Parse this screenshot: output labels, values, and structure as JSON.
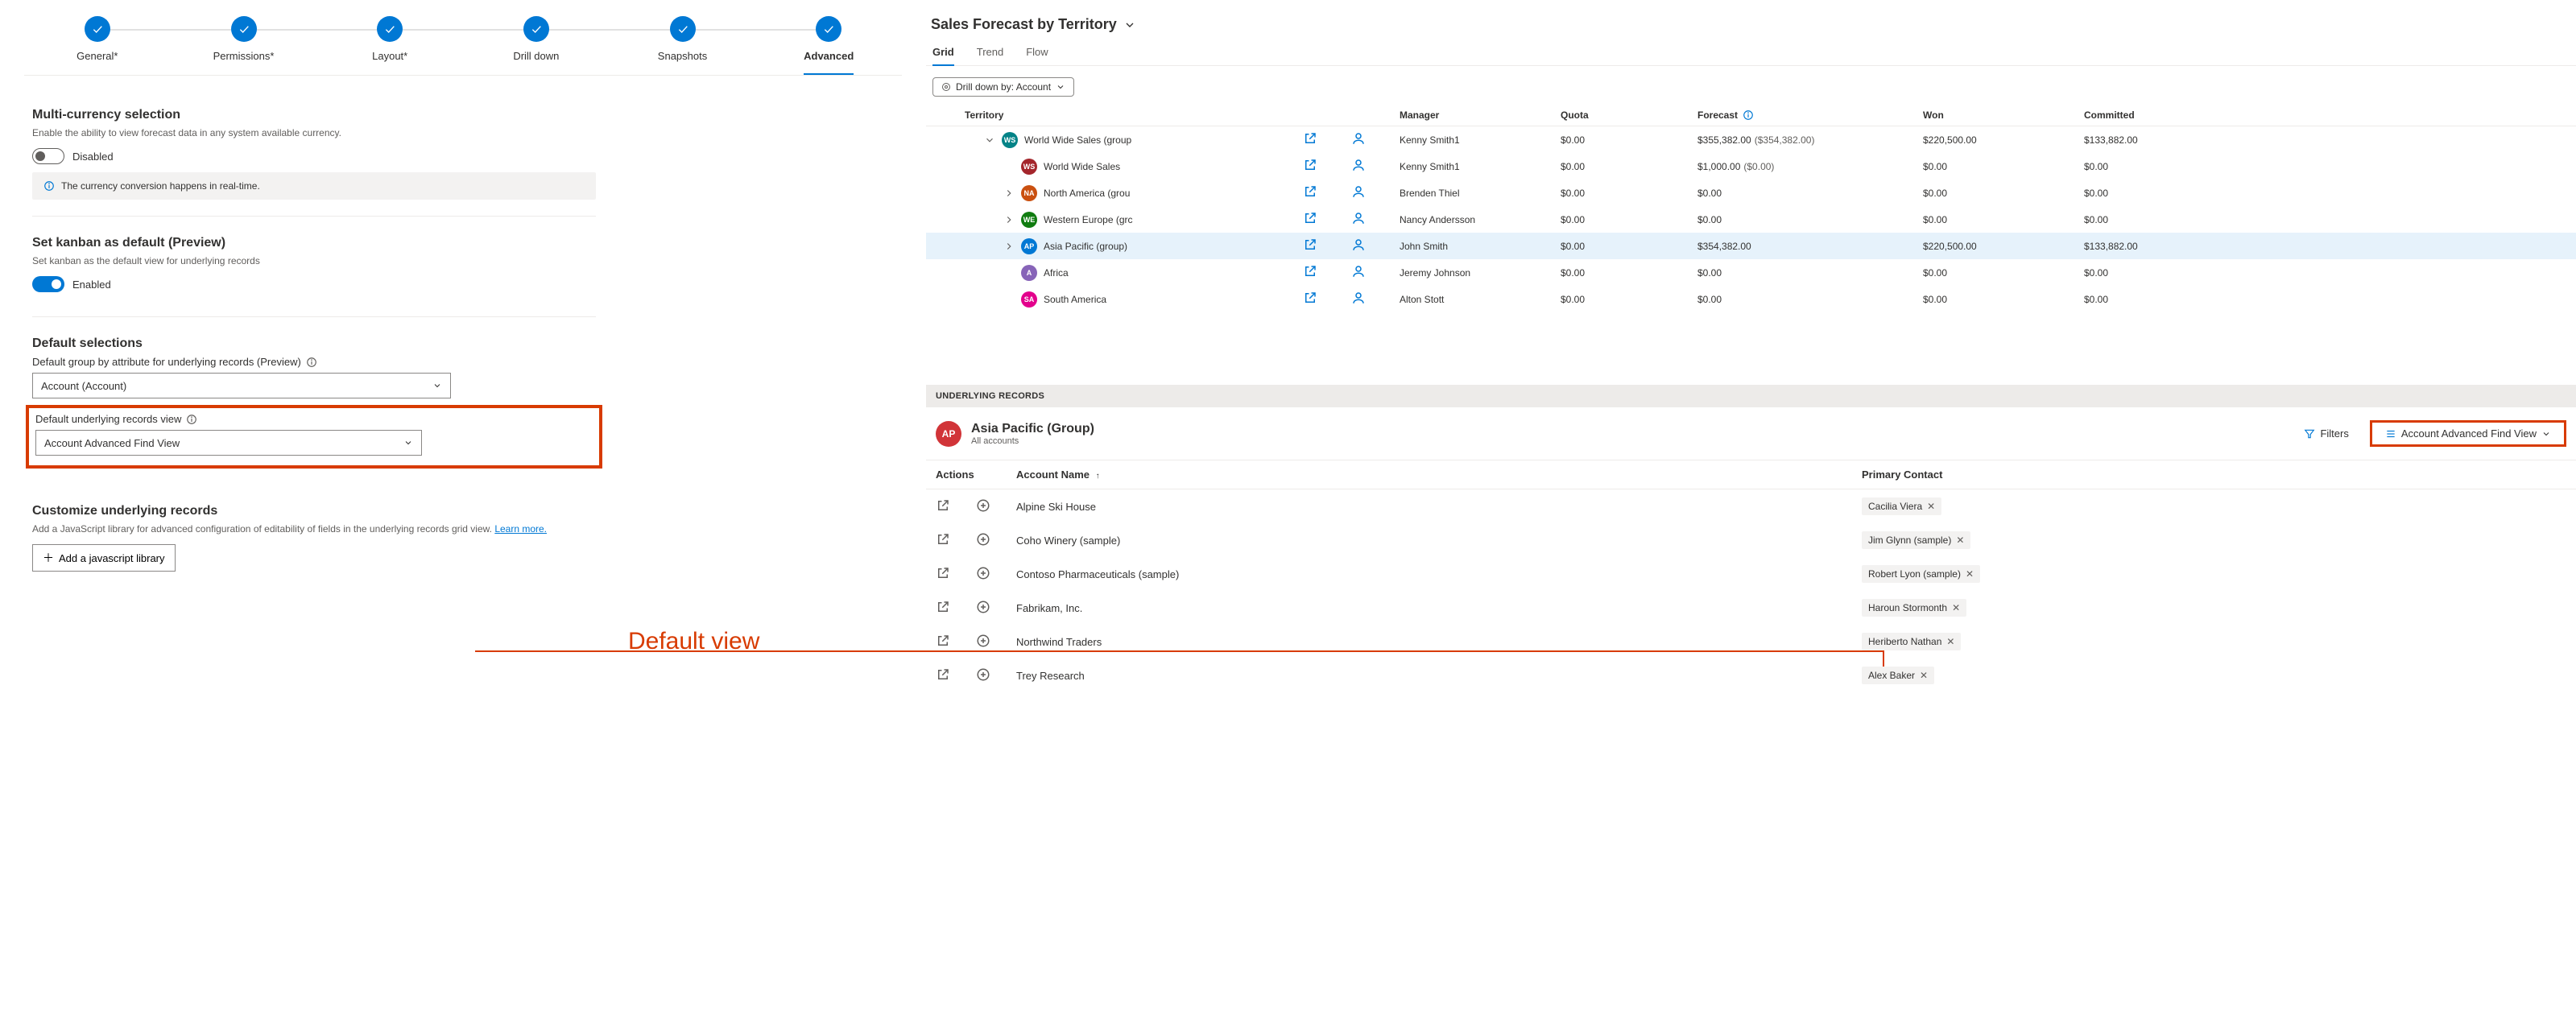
{
  "stepper": {
    "steps": [
      {
        "label": "General*"
      },
      {
        "label": "Permissions*"
      },
      {
        "label": "Layout*"
      },
      {
        "label": "Drill down"
      },
      {
        "label": "Snapshots"
      },
      {
        "label": "Advanced"
      }
    ]
  },
  "settings": {
    "multicurrency": {
      "title": "Multi-currency selection",
      "desc": "Enable the ability to view forecast data in any system available currency.",
      "toggle_label": "Disabled",
      "info_text": "The currency conversion happens in real-time."
    },
    "kanban": {
      "title": "Set kanban as default (Preview)",
      "desc": "Set kanban as the default view for underlying records",
      "toggle_label": "Enabled"
    },
    "defaults": {
      "title": "Default selections",
      "group_label": "Default group by attribute for underlying records (Preview)",
      "group_value": "Account (Account)",
      "view_label": "Default underlying records view",
      "view_value": "Account Advanced Find View"
    },
    "customize": {
      "title": "Customize underlying records",
      "desc": "Add a JavaScript library for advanced configuration of editability of fields in the underlying records grid view. ",
      "link": "Learn more.",
      "button": "Add a javascript library"
    }
  },
  "annotation": "Default view",
  "right": {
    "page_title": "Sales Forecast by Territory",
    "tabs": [
      {
        "label": "Grid",
        "active": true
      },
      {
        "label": "Trend",
        "active": false
      },
      {
        "label": "Flow",
        "active": false
      }
    ],
    "drilldown_pill": "Drill down by: Account",
    "columns": {
      "territory": "Territory",
      "manager": "Manager",
      "quota": "Quota",
      "forecast": "Forecast",
      "won": "Won",
      "committed": "Committed"
    },
    "rows": [
      {
        "indent": 1,
        "chev": "down",
        "badge": "WS",
        "color": "#038387",
        "name": "World Wide Sales (group",
        "manager": "Kenny Smith1",
        "quota": "$0.00",
        "forecast": "$355,382.00",
        "forecast2": "($354,382.00)",
        "won": "$220,500.00",
        "committed": "$133,882.00"
      },
      {
        "indent": 2,
        "chev": "",
        "badge": "WS",
        "color": "#a4262c",
        "name": "World Wide Sales",
        "manager": "Kenny Smith1",
        "quota": "$0.00",
        "forecast": "$1,000.00",
        "forecast2": "($0.00)",
        "won": "$0.00",
        "committed": "$0.00"
      },
      {
        "indent": 2,
        "chev": "right",
        "badge": "NA",
        "color": "#ca5010",
        "name": "North America (grou",
        "manager": "Brenden Thiel",
        "quota": "$0.00",
        "forecast": "$0.00",
        "forecast2": "",
        "won": "$0.00",
        "committed": "$0.00"
      },
      {
        "indent": 2,
        "chev": "right",
        "badge": "WE",
        "color": "#107c10",
        "name": "Western Europe (grc",
        "manager": "Nancy Andersson",
        "quota": "$0.00",
        "forecast": "$0.00",
        "forecast2": "",
        "won": "$0.00",
        "committed": "$0.00"
      },
      {
        "indent": 2,
        "chev": "right",
        "badge": "AP",
        "color": "#0078d4",
        "name": "Asia Pacific (group)",
        "manager": "John Smith",
        "quota": "$0.00",
        "forecast": "$354,382.00",
        "forecast2": "",
        "won": "$220,500.00",
        "committed": "$133,882.00",
        "highlight": true
      },
      {
        "indent": 2,
        "chev": "",
        "badge": "A",
        "color": "#8764b8",
        "name": "Africa",
        "manager": "Jeremy Johnson",
        "quota": "$0.00",
        "forecast": "$0.00",
        "forecast2": "",
        "won": "$0.00",
        "committed": "$0.00"
      },
      {
        "indent": 2,
        "chev": "",
        "badge": "SA",
        "color": "#e3008c",
        "name": "South America",
        "manager": "Alton Stott",
        "quota": "$0.00",
        "forecast": "$0.00",
        "forecast2": "",
        "won": "$0.00",
        "committed": "$0.00"
      }
    ],
    "underlying": {
      "bar_label": "UNDERLYING RECORDS",
      "avatar": "AP",
      "title": "Asia Pacific (Group)",
      "subtitle": "All accounts",
      "filters_label": "Filters",
      "view_label": "Account Advanced Find View",
      "columns": {
        "actions": "Actions",
        "account": "Account Name",
        "contact": "Primary Contact"
      },
      "rows": [
        {
          "name": "Alpine Ski House",
          "contact": "Cacilia Viera"
        },
        {
          "name": "Coho Winery (sample)",
          "contact": "Jim Glynn (sample)"
        },
        {
          "name": "Contoso Pharmaceuticals (sample)",
          "contact": "Robert Lyon (sample)"
        },
        {
          "name": "Fabrikam, Inc.",
          "contact": "Haroun Stormonth"
        },
        {
          "name": "Northwind Traders",
          "contact": "Heriberto Nathan"
        },
        {
          "name": "Trey Research",
          "contact": "Alex Baker"
        }
      ]
    }
  }
}
